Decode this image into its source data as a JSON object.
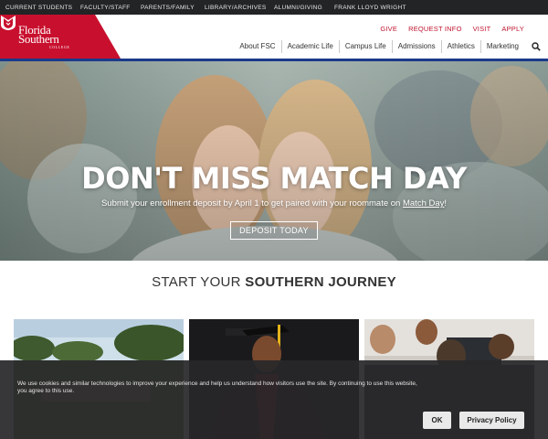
{
  "utility_nav": {
    "items": [
      {
        "label": "CURRENT STUDENTS"
      },
      {
        "label": "FACULTY/STAFF"
      },
      {
        "label": "PARENTS/FAMILY"
      },
      {
        "label": "LIBRARY/ARCHIVES"
      },
      {
        "label": "ALUMNI/GIVING"
      },
      {
        "label": "FRANK LLOYD WRIGHT"
      }
    ]
  },
  "brand": {
    "name_line1": "Florida",
    "name_line2": "Southern",
    "name_line3": "COLLEGE",
    "color_red": "#c8102e",
    "color_blue": "#1a3a8a"
  },
  "quick_links": {
    "items": [
      {
        "label": "GIVE"
      },
      {
        "label": "REQUEST INFO"
      },
      {
        "label": "VISIT"
      },
      {
        "label": "APPLY"
      }
    ]
  },
  "main_nav": {
    "items": [
      {
        "label": "About FSC"
      },
      {
        "label": "Academic Life"
      },
      {
        "label": "Campus Life"
      },
      {
        "label": "Admissions"
      },
      {
        "label": "Athletics"
      },
      {
        "label": "Marketing"
      }
    ],
    "search_icon": "search-icon"
  },
  "hero": {
    "title": "DON'T MISS MATCH DAY",
    "subtitle_prefix": "Submit your enrollment deposit by April 1 to get paired with your roommate on ",
    "subtitle_link": "Match Day",
    "subtitle_suffix": "!",
    "button_label": "DEPOSIT TODAY"
  },
  "journey": {
    "title_prefix": "START YOUR ",
    "title_bold": "SOUTHERN JOURNEY"
  },
  "cookie_banner": {
    "text": "We use cookies and similar technologies to improve your experience and help us understand how visitors use the site. By continuing to use this website, you agree to this use.",
    "ok_label": "OK",
    "policy_label": "Privacy Policy"
  }
}
